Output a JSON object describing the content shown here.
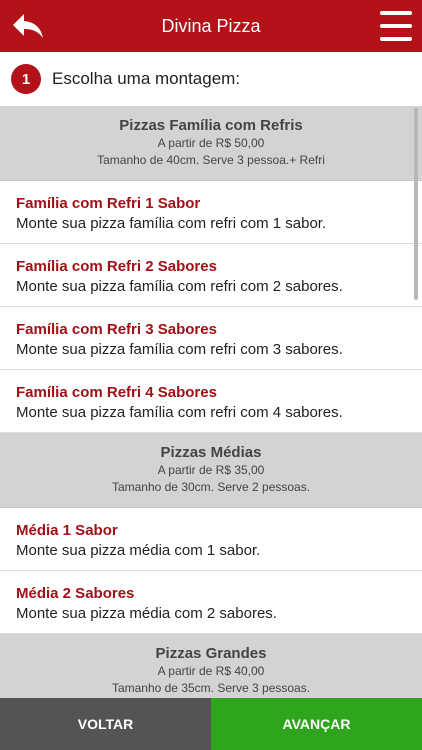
{
  "header": {
    "title": "Divina Pizza",
    "back_icon": "reply-arrow-icon",
    "menu_icon": "hamburger-menu-icon"
  },
  "step": {
    "number": "1",
    "label": "Escolha uma montagem:"
  },
  "groups": [
    {
      "title": "Pizzas Família com Refris",
      "price": "A partir de R$ 50,00",
      "info": "Tamanho de 40cm. Serve 3 pessoa.+ Refri",
      "items": [
        {
          "title": "Família com Refri 1 Sabor",
          "desc": "Monte sua pizza família com refri com 1 sabor."
        },
        {
          "title": "Família com Refri 2 Sabores",
          "desc": "Monte sua pizza família com refri com 2 sabores."
        },
        {
          "title": "Família com Refri 3 Sabores",
          "desc": "Monte sua pizza família com refri com 3 sabores."
        },
        {
          "title": "Família com Refri 4 Sabores",
          "desc": "Monte sua pizza família com refri com 4 sabores."
        }
      ]
    },
    {
      "title": "Pizzas Médias",
      "price": "A partir de R$ 35,00",
      "info": "Tamanho de 30cm. Serve 2 pessoas.",
      "items": [
        {
          "title": "Média 1 Sabor",
          "desc": "Monte sua pizza média com 1 sabor."
        },
        {
          "title": "Média 2 Sabores",
          "desc": "Monte sua pizza média com 2 sabores."
        }
      ]
    },
    {
      "title": "Pizzas Grandes",
      "price": "A partir de R$ 40,00",
      "info": "Tamanho de 35cm. Serve 3 pessoas.",
      "items": []
    }
  ],
  "footer": {
    "back_label": "VOLTAR",
    "next_label": "AVANÇAR"
  },
  "colors": {
    "brand": "#b21218",
    "next": "#2fa51d",
    "back": "#545454"
  }
}
